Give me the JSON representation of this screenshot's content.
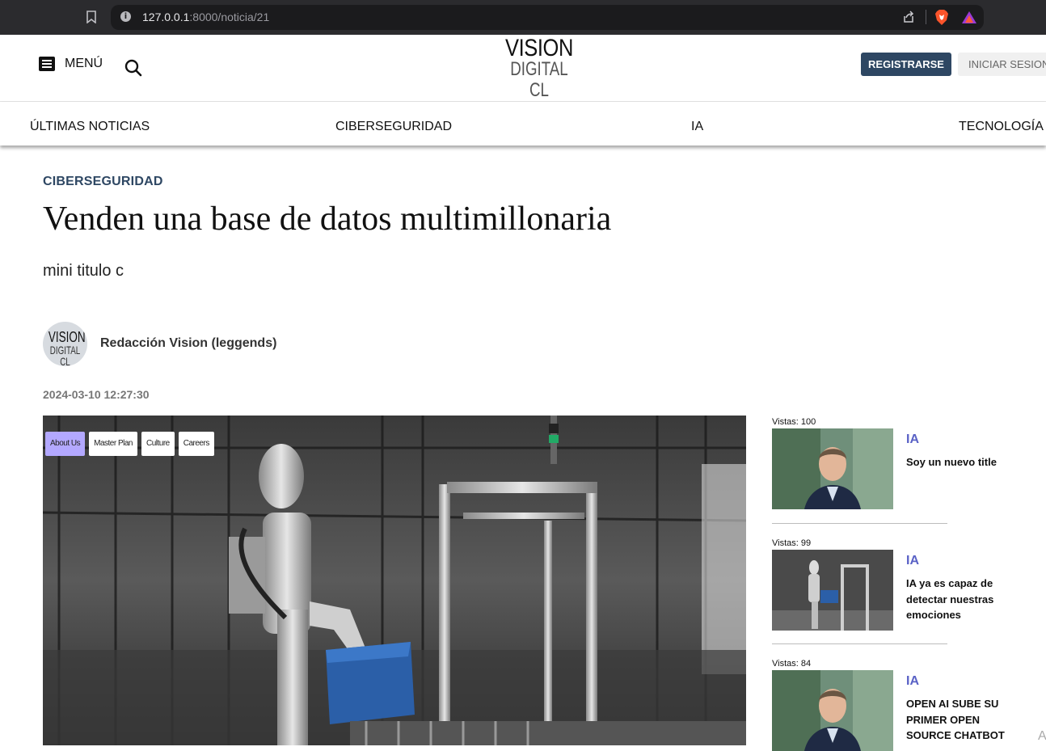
{
  "browser": {
    "url_host": "127.0.0.1",
    "url_rest": ":8000/noticia/21"
  },
  "header": {
    "menu_label": "MENÚ",
    "logo_line1": "VISION",
    "logo_line2": "DIGITAL CL",
    "register_label": "REGISTRARSE",
    "login_label": "INICIAR SESION"
  },
  "nav": {
    "items": [
      {
        "label": "ÚLTIMAS NOTICIAS"
      },
      {
        "label": "CIBERSEGURIDAD"
      },
      {
        "label": "IA"
      },
      {
        "label": "TECNOLOGÍA"
      }
    ]
  },
  "article": {
    "category": "CIBERSEGURIDAD",
    "title": "Venden una base de datos multimillonaria",
    "subtitle": "mini titulo c",
    "author": "Redacción Vision (leggends)",
    "avatar_line1": "VISION",
    "avatar_line2": "DIGITAL CL",
    "date": "2024-03-10 12:27:30",
    "hero_tabs": [
      "About Us",
      "Master Plan",
      "Culture",
      "Careers"
    ]
  },
  "sidebar": {
    "items": [
      {
        "views": "Vistas: 100",
        "category": "IA",
        "title": "Soy un nuevo title",
        "thumb": "man-portrait-icon"
      },
      {
        "views": "Vistas: 99",
        "category": "IA",
        "title": "IA ya es capaz de detectar nuestras emociones",
        "thumb": "robot-factory-icon"
      },
      {
        "views": "Vistas: 84",
        "category": "IA",
        "title": "OPEN AI SUBE SU PRIMER OPEN SOURCE CHATBOT",
        "thumb": "man-portrait-icon"
      }
    ]
  },
  "misc": {
    "corner_letter": "A"
  },
  "colors": {
    "brand_navy": "#2e4763",
    "sidebar_category": "#5a62c6",
    "active_tab": "#b3a8ff",
    "chrome_bg": "#2b2b2e"
  }
}
